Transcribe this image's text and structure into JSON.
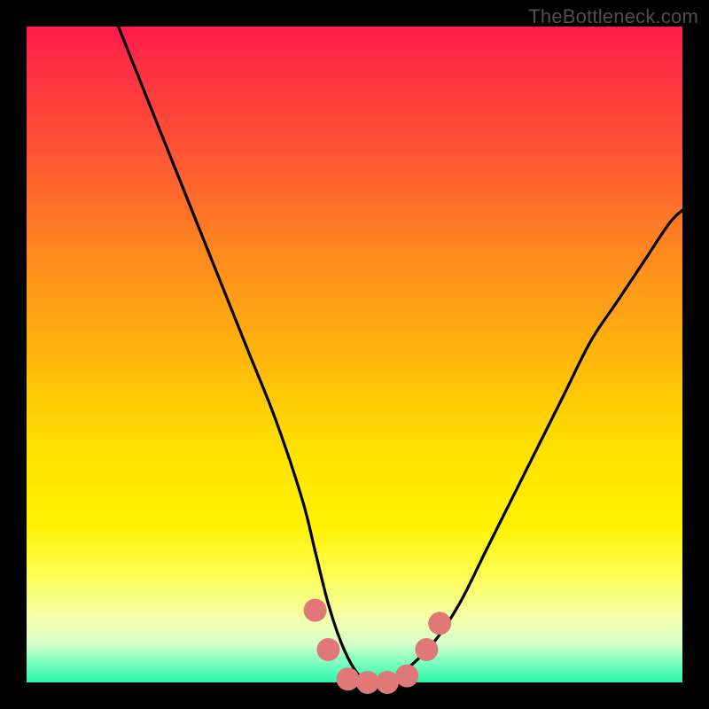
{
  "watermark": "TheBottleneck.com",
  "chart_data": {
    "type": "line",
    "title": "",
    "xlabel": "",
    "ylabel": "",
    "xlim": [
      0,
      100
    ],
    "ylim": [
      0,
      100
    ],
    "series": [
      {
        "name": "bottleneck-curve",
        "color": "#000000",
        "x": [
          14,
          18,
          22,
          26,
          30,
          34,
          38,
          42,
          44,
          46,
          48,
          50,
          52,
          54,
          56,
          58,
          62,
          66,
          70,
          74,
          78,
          82,
          86,
          90,
          94,
          98,
          100
        ],
        "values": [
          100,
          90,
          80,
          70,
          60,
          50,
          40,
          28,
          20,
          12,
          6,
          2,
          0,
          0,
          0,
          2,
          6,
          12,
          20,
          28,
          36,
          44,
          52,
          58,
          64,
          70,
          72
        ]
      }
    ],
    "markers": {
      "name": "highlight-dots",
      "color": "#e07878",
      "points": [
        {
          "x": 44,
          "y": 11
        },
        {
          "x": 46,
          "y": 5
        },
        {
          "x": 49,
          "y": 0.5
        },
        {
          "x": 52,
          "y": 0
        },
        {
          "x": 55,
          "y": 0
        },
        {
          "x": 58,
          "y": 1
        },
        {
          "x": 61,
          "y": 5
        },
        {
          "x": 63,
          "y": 9
        }
      ]
    },
    "background_gradient": {
      "top": "#ff1a4b",
      "mid": "#ffe000",
      "bottom": "#28f5a7"
    }
  }
}
